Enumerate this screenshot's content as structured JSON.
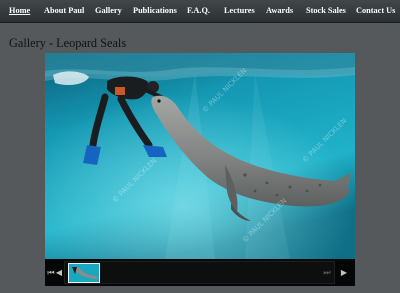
{
  "nav": {
    "items": [
      {
        "label": "Home",
        "active": true
      },
      {
        "label": "About Paul",
        "active": false
      },
      {
        "label": "Gallery",
        "active": false
      },
      {
        "label": "Publications",
        "active": false
      },
      {
        "label": "F.A.Q.",
        "active": false
      },
      {
        "label": "Lectures",
        "active": false
      },
      {
        "label": "Awards",
        "active": false
      },
      {
        "label": "Stock Sales",
        "active": false
      },
      {
        "label": "Contact Us",
        "active": false
      }
    ]
  },
  "page": {
    "title": "Gallery - Leopard Seals"
  },
  "viewer": {
    "watermark": "© PAUL NICKLEN",
    "controls": {
      "first": "⏮",
      "prev": "◀",
      "next": "⏭",
      "play": "▶"
    }
  },
  "colors": {
    "nav_bg": "#2c3033",
    "page_bg": "#55595c",
    "water": "#1aa7c0",
    "seal": "#8a8d8a"
  }
}
